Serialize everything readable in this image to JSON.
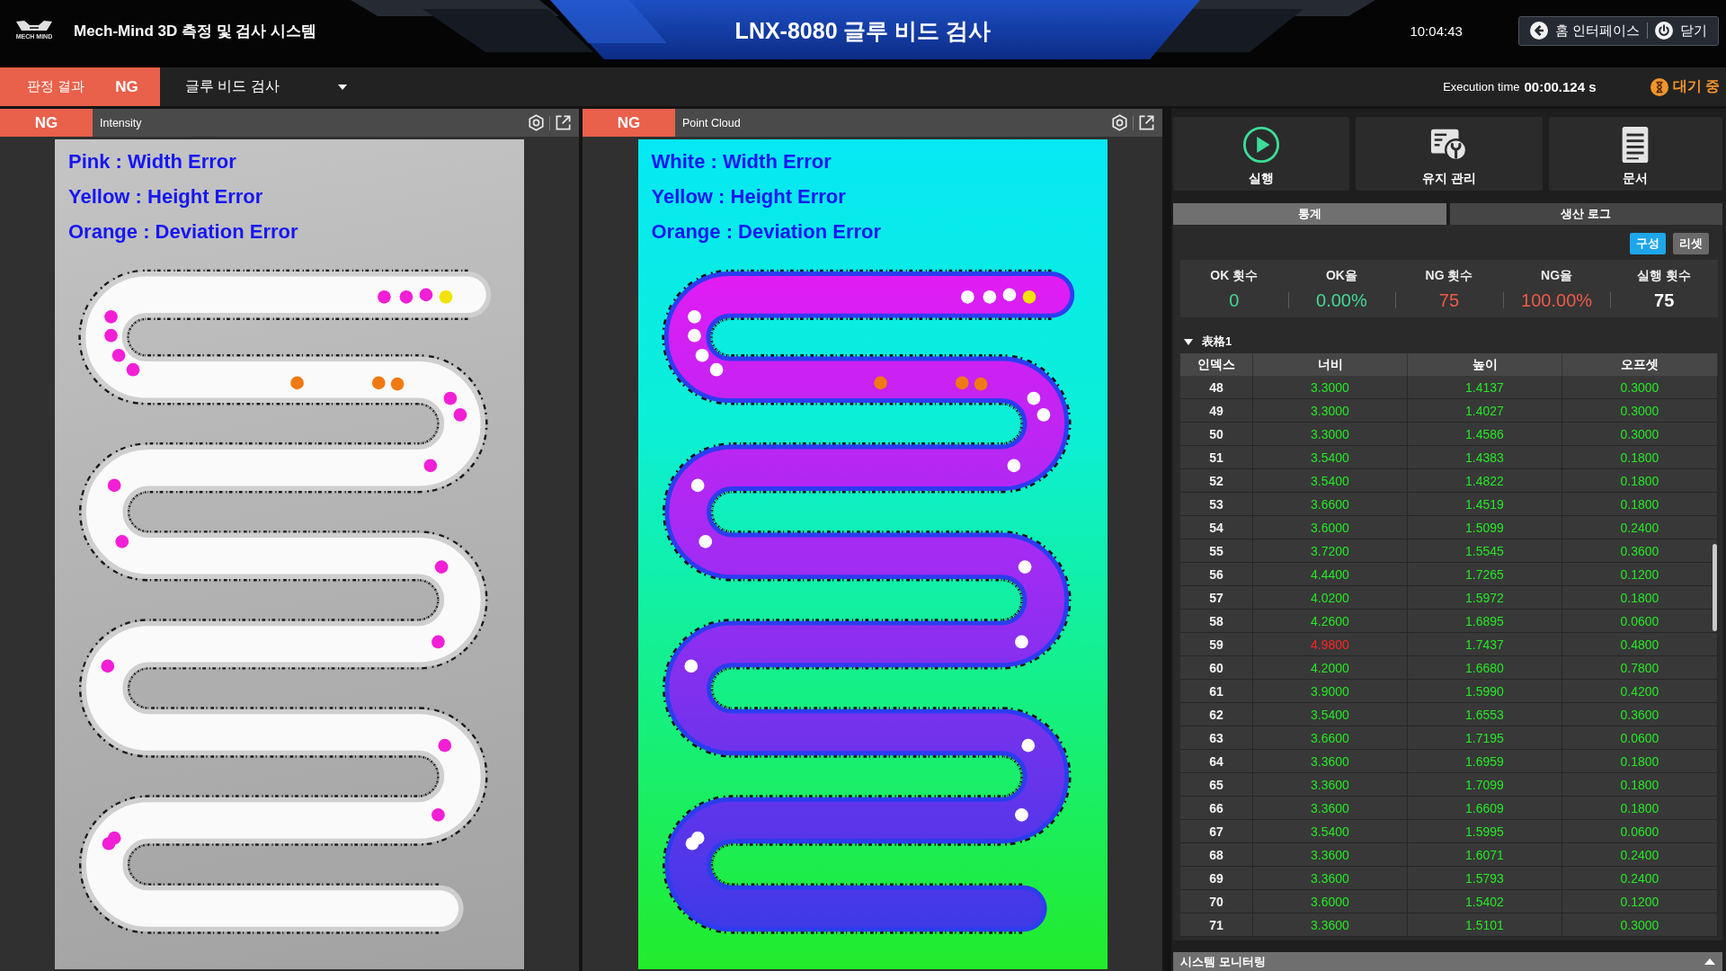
{
  "header": {
    "logo_text": "MECH MIND",
    "app_title": "Mech-Mind 3D 측정 및 검사 시스템",
    "title": "LNX-8080 글루 비드 검사",
    "time": "10:04:43",
    "buttons": [
      {
        "kind": "home",
        "label": "홈 인터페이스"
      },
      {
        "kind": "close",
        "label": "닫기"
      }
    ]
  },
  "judgement": {
    "label": "판정 결과",
    "result": "NG",
    "passed": false
  },
  "recipe_dropdown": {
    "value": "글루 비드 검사"
  },
  "execution": {
    "label": "Execution time",
    "value": "00:00.124 s"
  },
  "status": {
    "label": "대기 중"
  },
  "views": [
    {
      "result": "NG",
      "passed": false,
      "title": "Intensity",
      "kind": "intensity",
      "legend": [
        "Pink : Width Error",
        "Yellow : Height Error",
        "Orange : Deviation Error"
      ],
      "markers": [
        {
          "color": "#f21fd6"
        },
        {
          "color": "#f21fd6"
        },
        {
          "color": "#f21fd6"
        },
        {
          "color": "#f2e205"
        },
        {
          "color": "#f21fd6"
        },
        {
          "color": "#f21fd6"
        },
        {
          "color": "#f21fd6"
        },
        {
          "color": "#f21fd6"
        },
        {
          "color": "#f07a12"
        },
        {
          "color": "#f07a12"
        },
        {
          "color": "#f07a12"
        },
        {
          "color": "#f21fd6"
        },
        {
          "color": "#f21fd6"
        },
        {
          "color": "#f21fd6"
        },
        {
          "color": "#f21fd6"
        },
        {
          "color": "#f21fd6"
        },
        {
          "color": "#f21fd6"
        },
        {
          "color": "#f21fd6"
        },
        {
          "color": "#f21fd6"
        },
        {
          "color": "#f21fd6"
        },
        {
          "color": "#f21fd6"
        },
        {
          "color": "#f21fd6"
        },
        {
          "color": "#f21fd6"
        }
      ]
    },
    {
      "result": "NG",
      "passed": false,
      "title": "Point Cloud",
      "kind": "point_cloud",
      "legend": [
        "White : Width Error",
        "Yellow : Height Error",
        "Orange : Deviation Error"
      ],
      "markers": [
        {
          "color": "#ffffff"
        },
        {
          "color": "#ffffff"
        },
        {
          "color": "#ffffff"
        },
        {
          "color": "#f2e205"
        },
        {
          "color": "#ffffff"
        },
        {
          "color": "#ffffff"
        },
        {
          "color": "#ffffff"
        },
        {
          "color": "#ffffff"
        },
        {
          "color": "#f07a12"
        },
        {
          "color": "#f07a12"
        },
        {
          "color": "#f07a12"
        },
        {
          "color": "#ffffff"
        },
        {
          "color": "#ffffff"
        },
        {
          "color": "#ffffff"
        },
        {
          "color": "#ffffff"
        },
        {
          "color": "#ffffff"
        },
        {
          "color": "#ffffff"
        },
        {
          "color": "#ffffff"
        },
        {
          "color": "#ffffff"
        },
        {
          "color": "#ffffff"
        },
        {
          "color": "#ffffff"
        },
        {
          "color": "#ffffff"
        },
        {
          "color": "#ffffff"
        }
      ]
    }
  ],
  "actions": [
    {
      "kind": "run",
      "label": "실행"
    },
    {
      "kind": "maintenance",
      "label": "유지 관리"
    },
    {
      "kind": "docs",
      "label": "문서"
    }
  ],
  "tabs": [
    {
      "label": "통계",
      "selected": true
    },
    {
      "label": "생산 로그",
      "selected": false
    }
  ],
  "stat_buttons": [
    {
      "kind": "configure",
      "label": "구성"
    },
    {
      "kind": "reset",
      "label": "리셋"
    }
  ],
  "stats": [
    {
      "label": "OK 횟수",
      "value": "0",
      "kind": "ok"
    },
    {
      "label": "OK율",
      "value": "0.00%",
      "kind": "ok"
    },
    {
      "label": "NG 횟수",
      "value": "75",
      "kind": "ng"
    },
    {
      "label": "NG율",
      "value": "100.00%",
      "kind": "ng"
    },
    {
      "label": "실행 횟수",
      "value": "75",
      "kind": "total"
    }
  ],
  "table": {
    "title": "表格1",
    "expanded": true,
    "columns": [
      "인덱스",
      "너비",
      "높이",
      "오프셋"
    ],
    "rows": [
      {
        "cells": [
          {
            "text": "48",
            "ng": false
          },
          {
            "text": "3.3000",
            "ng": false
          },
          {
            "text": "1.4137",
            "ng": false
          },
          {
            "text": "0.3000",
            "ng": false
          }
        ]
      },
      {
        "cells": [
          {
            "text": "49",
            "ng": false
          },
          {
            "text": "3.3000",
            "ng": false
          },
          {
            "text": "1.4027",
            "ng": false
          },
          {
            "text": "0.3000",
            "ng": false
          }
        ]
      },
      {
        "cells": [
          {
            "text": "50",
            "ng": false
          },
          {
            "text": "3.3000",
            "ng": false
          },
          {
            "text": "1.4586",
            "ng": false
          },
          {
            "text": "0.3000",
            "ng": false
          }
        ]
      },
      {
        "cells": [
          {
            "text": "51",
            "ng": false
          },
          {
            "text": "3.5400",
            "ng": false
          },
          {
            "text": "1.4383",
            "ng": false
          },
          {
            "text": "0.1800",
            "ng": false
          }
        ]
      },
      {
        "cells": [
          {
            "text": "52",
            "ng": false
          },
          {
            "text": "3.5400",
            "ng": false
          },
          {
            "text": "1.4822",
            "ng": false
          },
          {
            "text": "0.1800",
            "ng": false
          }
        ]
      },
      {
        "cells": [
          {
            "text": "53",
            "ng": false
          },
          {
            "text": "3.6600",
            "ng": false
          },
          {
            "text": "1.4519",
            "ng": false
          },
          {
            "text": "0.1800",
            "ng": false
          }
        ]
      },
      {
        "cells": [
          {
            "text": "54",
            "ng": false
          },
          {
            "text": "3.6000",
            "ng": false
          },
          {
            "text": "1.5099",
            "ng": false
          },
          {
            "text": "0.2400",
            "ng": false
          }
        ]
      },
      {
        "cells": [
          {
            "text": "55",
            "ng": false
          },
          {
            "text": "3.7200",
            "ng": false
          },
          {
            "text": "1.5545",
            "ng": false
          },
          {
            "text": "0.3600",
            "ng": false
          }
        ]
      },
      {
        "cells": [
          {
            "text": "56",
            "ng": false
          },
          {
            "text": "4.4400",
            "ng": false
          },
          {
            "text": "1.7265",
            "ng": false
          },
          {
            "text": "0.1200",
            "ng": false
          }
        ]
      },
      {
        "cells": [
          {
            "text": "57",
            "ng": false
          },
          {
            "text": "4.0200",
            "ng": false
          },
          {
            "text": "1.5972",
            "ng": false
          },
          {
            "text": "0.1800",
            "ng": false
          }
        ]
      },
      {
        "cells": [
          {
            "text": "58",
            "ng": false
          },
          {
            "text": "4.2600",
            "ng": false
          },
          {
            "text": "1.6895",
            "ng": false
          },
          {
            "text": "0.0600",
            "ng": false
          }
        ]
      },
      {
        "cells": [
          {
            "text": "59",
            "ng": false
          },
          {
            "text": "4.9800",
            "ng": true
          },
          {
            "text": "1.7437",
            "ng": false
          },
          {
            "text": "0.4800",
            "ng": false
          }
        ]
      },
      {
        "cells": [
          {
            "text": "60",
            "ng": false
          },
          {
            "text": "4.2000",
            "ng": false
          },
          {
            "text": "1.6680",
            "ng": false
          },
          {
            "text": "0.7800",
            "ng": false
          }
        ]
      },
      {
        "cells": [
          {
            "text": "61",
            "ng": false
          },
          {
            "text": "3.9000",
            "ng": false
          },
          {
            "text": "1.5990",
            "ng": false
          },
          {
            "text": "0.4200",
            "ng": false
          }
        ]
      },
      {
        "cells": [
          {
            "text": "62",
            "ng": false
          },
          {
            "text": "3.5400",
            "ng": false
          },
          {
            "text": "1.6553",
            "ng": false
          },
          {
            "text": "0.3600",
            "ng": false
          }
        ]
      },
      {
        "cells": [
          {
            "text": "63",
            "ng": false
          },
          {
            "text": "3.6600",
            "ng": false
          },
          {
            "text": "1.7195",
            "ng": false
          },
          {
            "text": "0.0600",
            "ng": false
          }
        ]
      },
      {
        "cells": [
          {
            "text": "64",
            "ng": false
          },
          {
            "text": "3.3600",
            "ng": false
          },
          {
            "text": "1.6959",
            "ng": false
          },
          {
            "text": "0.1800",
            "ng": false
          }
        ]
      },
      {
        "cells": [
          {
            "text": "65",
            "ng": false
          },
          {
            "text": "3.3600",
            "ng": false
          },
          {
            "text": "1.7099",
            "ng": false
          },
          {
            "text": "0.1800",
            "ng": false
          }
        ]
      },
      {
        "cells": [
          {
            "text": "66",
            "ng": false
          },
          {
            "text": "3.3600",
            "ng": false
          },
          {
            "text": "1.6609",
            "ng": false
          },
          {
            "text": "0.1800",
            "ng": false
          }
        ]
      },
      {
        "cells": [
          {
            "text": "67",
            "ng": false
          },
          {
            "text": "3.5400",
            "ng": false
          },
          {
            "text": "1.5995",
            "ng": false
          },
          {
            "text": "0.0600",
            "ng": false
          }
        ]
      },
      {
        "cells": [
          {
            "text": "68",
            "ng": false
          },
          {
            "text": "3.3600",
            "ng": false
          },
          {
            "text": "1.6071",
            "ng": false
          },
          {
            "text": "0.2400",
            "ng": false
          }
        ]
      },
      {
        "cells": [
          {
            "text": "69",
            "ng": false
          },
          {
            "text": "3.3600",
            "ng": false
          },
          {
            "text": "1.5793",
            "ng": false
          },
          {
            "text": "0.2400",
            "ng": false
          }
        ]
      },
      {
        "cells": [
          {
            "text": "70",
            "ng": false
          },
          {
            "text": "3.6000",
            "ng": false
          },
          {
            "text": "1.5402",
            "ng": false
          },
          {
            "text": "0.1200",
            "ng": false
          }
        ]
      },
      {
        "cells": [
          {
            "text": "71",
            "ng": false
          },
          {
            "text": "3.3600",
            "ng": false
          },
          {
            "text": "1.5101",
            "ng": false
          },
          {
            "text": "0.3000",
            "ng": false
          }
        ]
      }
    ]
  },
  "monitor_bar": {
    "label": "시스템 모니터링",
    "expanded": false
  }
}
